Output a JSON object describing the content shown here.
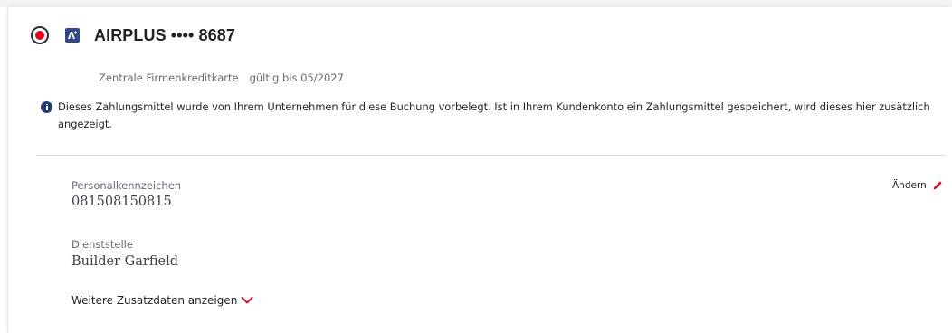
{
  "payment_method": {
    "selected": true,
    "name": "AIRPLUS •••• 8687",
    "card_type": "Zentrale Firmenkreditkarte",
    "valid_until": "gültig bis 05/2027",
    "logo_icon": "airplus-card-icon",
    "info_message": "Dieses Zahlungsmittel wurde von Ihrem Unternehmen für diese Buchung vorbelegt. Ist in Ihrem Kundenkonto ein Zahlungsmittel gespeichert, wird dieses hier zusätzlich angezeigt.",
    "info_icon": "info-icon"
  },
  "fields": [
    {
      "label": "Personalkennzeichen",
      "value": "081508150815"
    },
    {
      "label": "Dienststelle",
      "value": "Builder Garfield"
    }
  ],
  "actions": {
    "edit_label": "Ändern",
    "edit_icon": "pencil-icon",
    "more_label": "Weitere Zusatzdaten anzeigen",
    "more_icon": "chevron-down-icon"
  },
  "colors": {
    "accent": "#ec0016",
    "text": "#282d37",
    "muted": "#646973",
    "card_logo": "#2d4b8a",
    "info": "#1e3c78"
  }
}
